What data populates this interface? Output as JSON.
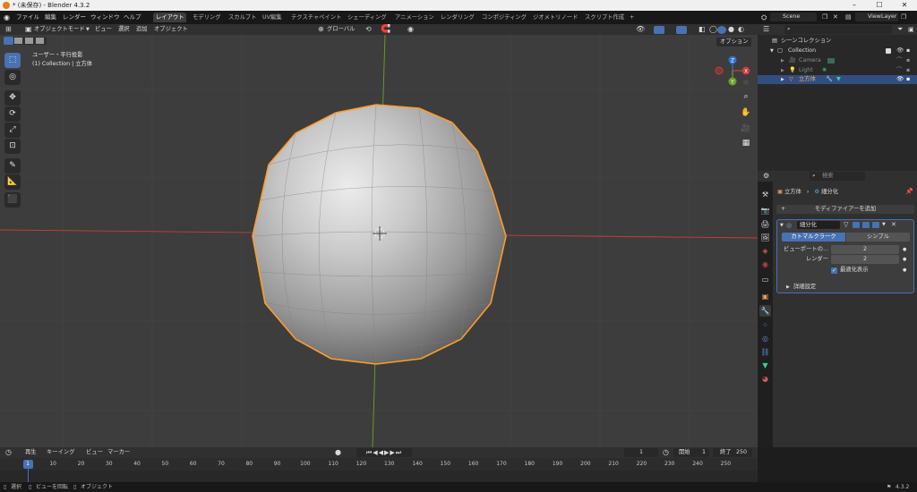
{
  "window": {
    "title": "* (未保存) - Blender 4.3.2"
  },
  "menus": [
    "ファイル",
    "編集",
    "レンダー",
    "ウィンドウ",
    "ヘルプ"
  ],
  "workspaces": [
    "レイアウト",
    "モデリング",
    "スカルプト",
    "UV編集",
    "テクスチャペイント",
    "シェーディング",
    "アニメーション",
    "レンダリング",
    "コンポジティング",
    "ジオメトリノード",
    "スクリプト作成"
  ],
  "workspace_add": "+",
  "scene": {
    "name": "Scene",
    "view_layer": "ViewLayer"
  },
  "viewport_header": {
    "mode": "オブジェクトモード",
    "menus": [
      "ビュー",
      "選択",
      "追加",
      "オブジェクト"
    ],
    "transform": "グローバル",
    "options": "オプション"
  },
  "viewport_info": {
    "line1": "ユーザー・平行投影",
    "line2": "(1) Collection | 立方体"
  },
  "gizmo": {
    "x": "X",
    "y": "Y",
    "z": "Z"
  },
  "outliner": {
    "search_placeholder": "",
    "scene_collection": "シーンコレクション",
    "collection": "Collection",
    "items": [
      "Camera",
      "Light",
      "立方体"
    ]
  },
  "properties": {
    "search_placeholder": "検索",
    "breadcrumb_object": "立方体",
    "breadcrumb_modifier": "細分化",
    "add_modifier": "モディファイアーを追加",
    "modifier_name": "細分化",
    "mode_catmull": "カトマルクラーク",
    "mode_simple": "シンプル",
    "viewport_label": "ビューポートの...",
    "viewport_value": "2",
    "render_label": "レンダー",
    "render_value": "2",
    "optimal_display": "最適化表示",
    "advanced": "詳細設定"
  },
  "timeline_header": {
    "menus": [
      "再生",
      "キーイング",
      "ビュー",
      "マーカー"
    ],
    "current_frame": "1",
    "start_label": "開始",
    "start_value": "1",
    "end_label": "終了",
    "end_value": "250"
  },
  "timeline_ticks": [
    "1",
    "10",
    "20",
    "30",
    "40",
    "50",
    "60",
    "70",
    "80",
    "90",
    "100",
    "110",
    "120",
    "130",
    "140",
    "150",
    "160",
    "170",
    "180",
    "190",
    "200",
    "210",
    "220",
    "230",
    "240",
    "250"
  ],
  "status": {
    "select": "選択",
    "rotate": "ビューを回転",
    "object": "オブジェクト",
    "version": "4.3.2"
  },
  "colors": {
    "accent": "#4772b3",
    "selection_outline": "#ff9c2b",
    "axis_x": "#c83c3c",
    "axis_y": "#6ea02a",
    "axis_z": "#2f73d7"
  }
}
